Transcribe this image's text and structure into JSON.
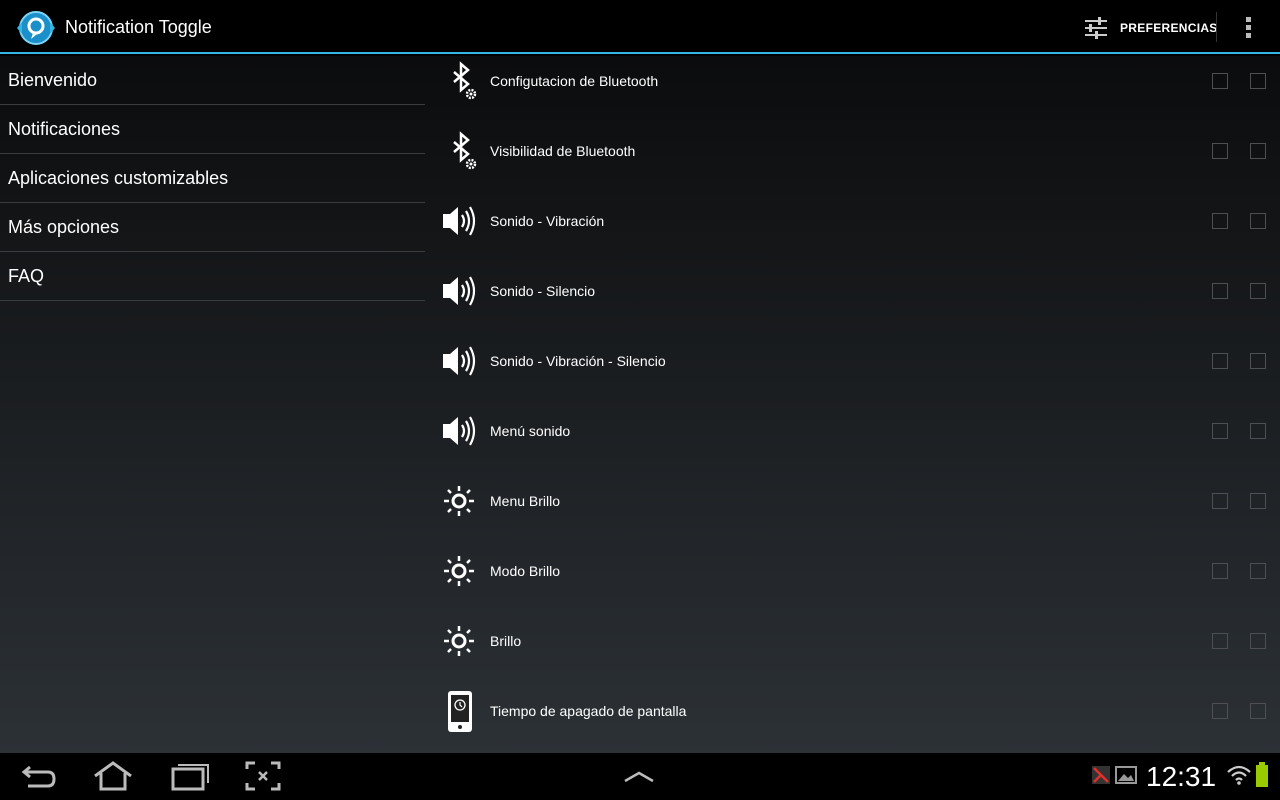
{
  "app": {
    "title": "Notification Toggle",
    "accent_color": "#33b5e5",
    "logo_icon": "app-logo-icon"
  },
  "actionbar": {
    "preferences_label": "PREFERENCIAS",
    "preferences_icon": "sliders-icon",
    "overflow_icon": "overflow-menu-icon"
  },
  "nav": {
    "items": [
      {
        "label": "Bienvenido"
      },
      {
        "label": "Notificaciones"
      },
      {
        "label": "Aplicaciones customizables"
      },
      {
        "label": "Más opciones"
      },
      {
        "label": "FAQ"
      }
    ]
  },
  "list": {
    "items": [
      {
        "label": "Configutacion de Bluetooth",
        "icon": "bluetooth-settings-icon",
        "checked_1": false,
        "checked_2": false
      },
      {
        "label": "Visibilidad de Bluetooth",
        "icon": "bluetooth-settings-icon",
        "checked_1": false,
        "checked_2": false
      },
      {
        "label": "Sonido - Vibración",
        "icon": "speaker-icon",
        "checked_1": false,
        "checked_2": false
      },
      {
        "label": "Sonido - Silencio",
        "icon": "speaker-icon",
        "checked_1": false,
        "checked_2": false
      },
      {
        "label": "Sonido - Vibración - Silencio",
        "icon": "speaker-icon",
        "checked_1": false,
        "checked_2": false
      },
      {
        "label": "Menú sonido",
        "icon": "speaker-icon",
        "checked_1": false,
        "checked_2": false
      },
      {
        "label": "Menu Brillo",
        "icon": "brightness-icon",
        "checked_1": false,
        "checked_2": false
      },
      {
        "label": "Modo Brillo",
        "icon": "brightness-icon",
        "checked_1": false,
        "checked_2": false
      },
      {
        "label": "Brillo",
        "icon": "brightness-icon",
        "checked_1": false,
        "checked_2": false
      },
      {
        "label": "Tiempo de apagado de pantalla",
        "icon": "phone-timeout-icon",
        "checked_1": false,
        "checked_2": false
      }
    ]
  },
  "systembar": {
    "clock": "12:31",
    "buttons": [
      "back-icon",
      "home-icon",
      "recent-apps-icon",
      "screenshot-icon",
      "chevron-up-icon"
    ],
    "status_icons": [
      "notification-icon",
      "image-icon",
      "wifi-icon",
      "battery-icon"
    ]
  }
}
